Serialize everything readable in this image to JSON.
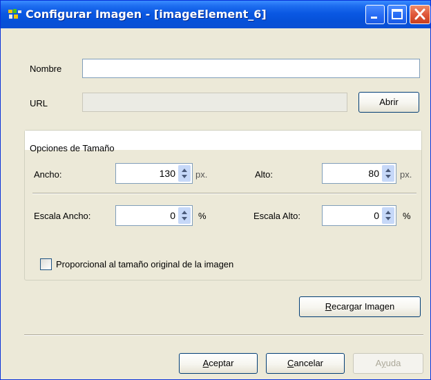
{
  "window": {
    "title": "Configurar Imagen - [imageElement_6]"
  },
  "form": {
    "nombre_label": "Nombre",
    "nombre_value": "",
    "url_label": "URL",
    "url_value": "",
    "abrir_label": "Abrir"
  },
  "size_options": {
    "title": "Opciones de Tamaño",
    "ancho_label": "Ancho:",
    "ancho_value": "130",
    "ancho_unit": "px.",
    "alto_label": "Alto:",
    "alto_value": "80",
    "alto_unit": "px.",
    "escala_ancho_label": "Escala Ancho:",
    "escala_ancho_value": "0",
    "escala_ancho_unit": "%",
    "escala_alto_label": "Escala Alto:",
    "escala_alto_value": "0",
    "escala_alto_unit": "%",
    "proporcional_label": "Proporcional al tamaño original de la imagen",
    "proporcional_checked": false
  },
  "buttons": {
    "recargar_first": "R",
    "recargar_rest": "ecargar Imagen",
    "aceptar_first": "A",
    "aceptar_rest": "ceptar",
    "cancelar_first": "C",
    "cancelar_rest": "ancelar",
    "ayuda_pre": "A",
    "ayuda_u": "y",
    "ayuda_post": "uda"
  },
  "colors": {
    "titlebar": "#0a58e3",
    "window_bg": "#ece9d8",
    "close_button": "#e0583a"
  }
}
